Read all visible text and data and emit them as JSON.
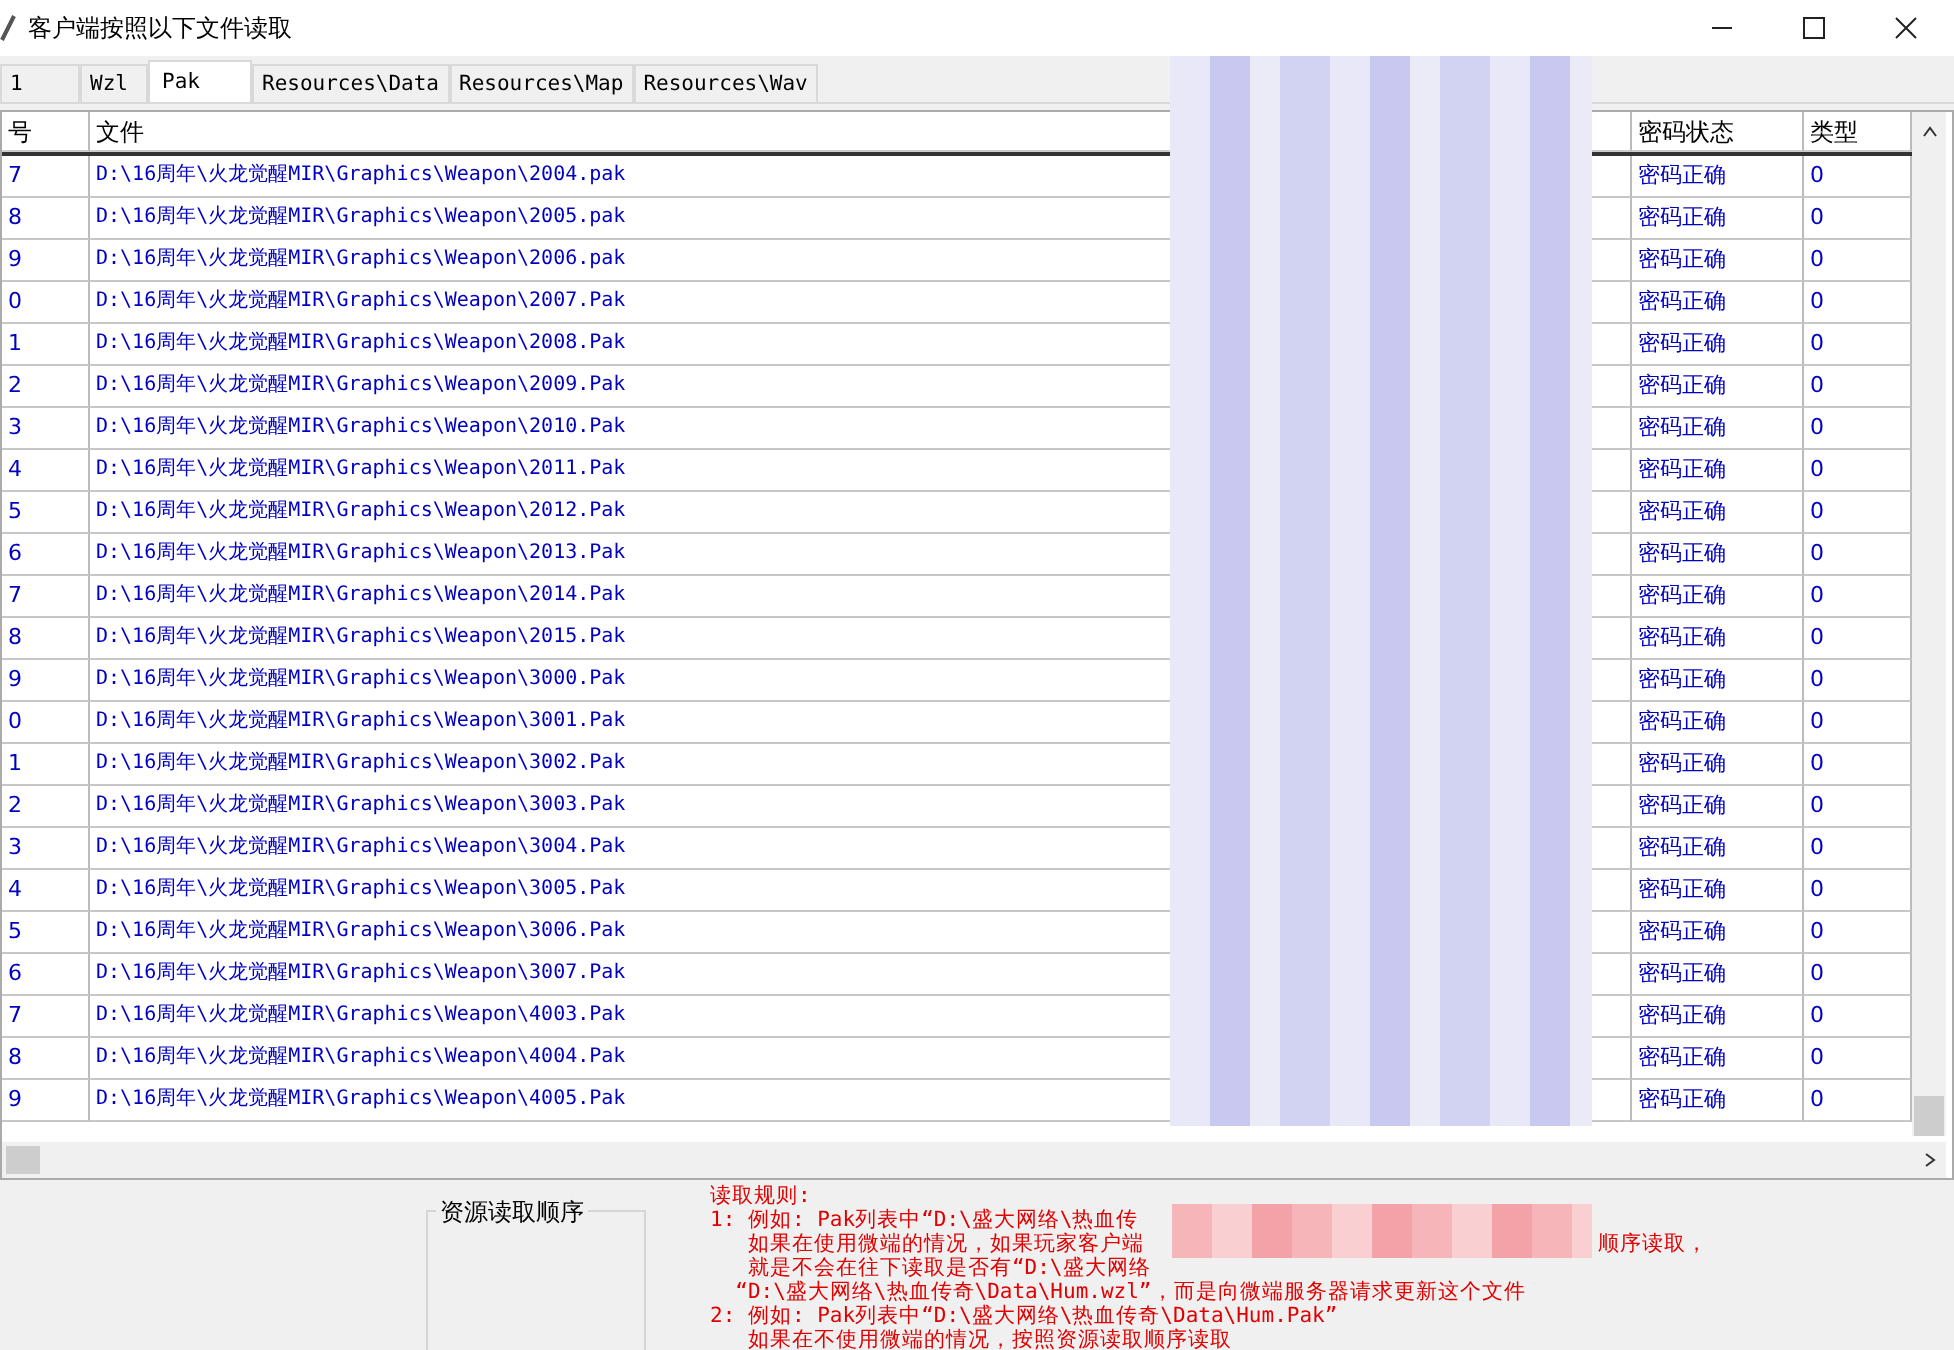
{
  "window": {
    "title": "客户端按照以下文件读取"
  },
  "tabs": [
    {
      "label": "1",
      "selected": false
    },
    {
      "label": "Wzl",
      "selected": false
    },
    {
      "label": "Pak",
      "selected": true
    },
    {
      "label": "Resources\\Data",
      "selected": false
    },
    {
      "label": "Resources\\Map",
      "selected": false
    },
    {
      "label": "Resources\\Wav",
      "selected": false
    }
  ],
  "table": {
    "columns": [
      "号",
      "文件",
      "密码状态",
      "类型"
    ],
    "rows": [
      {
        "no": "7",
        "file": "D:\\16周年\\火龙觉醒MIR\\Graphics\\Weapon\\2004.pak",
        "status": "密码正确",
        "type": "0"
      },
      {
        "no": "8",
        "file": "D:\\16周年\\火龙觉醒MIR\\Graphics\\Weapon\\2005.pak",
        "status": "密码正确",
        "type": "0"
      },
      {
        "no": "9",
        "file": "D:\\16周年\\火龙觉醒MIR\\Graphics\\Weapon\\2006.pak",
        "status": "密码正确",
        "type": "0"
      },
      {
        "no": "0",
        "file": "D:\\16周年\\火龙觉醒MIR\\Graphics\\Weapon\\2007.Pak",
        "status": "密码正确",
        "type": "0"
      },
      {
        "no": "1",
        "file": "D:\\16周年\\火龙觉醒MIR\\Graphics\\Weapon\\2008.Pak",
        "status": "密码正确",
        "type": "0"
      },
      {
        "no": "2",
        "file": "D:\\16周年\\火龙觉醒MIR\\Graphics\\Weapon\\2009.Pak",
        "status": "密码正确",
        "type": "0"
      },
      {
        "no": "3",
        "file": "D:\\16周年\\火龙觉醒MIR\\Graphics\\Weapon\\2010.Pak",
        "status": "密码正确",
        "type": "0"
      },
      {
        "no": "4",
        "file": "D:\\16周年\\火龙觉醒MIR\\Graphics\\Weapon\\2011.Pak",
        "status": "密码正确",
        "type": "0"
      },
      {
        "no": "5",
        "file": "D:\\16周年\\火龙觉醒MIR\\Graphics\\Weapon\\2012.Pak",
        "status": "密码正确",
        "type": "0"
      },
      {
        "no": "6",
        "file": "D:\\16周年\\火龙觉醒MIR\\Graphics\\Weapon\\2013.Pak",
        "status": "密码正确",
        "type": "0"
      },
      {
        "no": "7",
        "file": "D:\\16周年\\火龙觉醒MIR\\Graphics\\Weapon\\2014.Pak",
        "status": "密码正确",
        "type": "0"
      },
      {
        "no": "8",
        "file": "D:\\16周年\\火龙觉醒MIR\\Graphics\\Weapon\\2015.Pak",
        "status": "密码正确",
        "type": "0"
      },
      {
        "no": "9",
        "file": "D:\\16周年\\火龙觉醒MIR\\Graphics\\Weapon\\3000.Pak",
        "status": "密码正确",
        "type": "0"
      },
      {
        "no": "0",
        "file": "D:\\16周年\\火龙觉醒MIR\\Graphics\\Weapon\\3001.Pak",
        "status": "密码正确",
        "type": "0"
      },
      {
        "no": "1",
        "file": "D:\\16周年\\火龙觉醒MIR\\Graphics\\Weapon\\3002.Pak",
        "status": "密码正确",
        "type": "0"
      },
      {
        "no": "2",
        "file": "D:\\16周年\\火龙觉醒MIR\\Graphics\\Weapon\\3003.Pak",
        "status": "密码正确",
        "type": "0"
      },
      {
        "no": "3",
        "file": "D:\\16周年\\火龙觉醒MIR\\Graphics\\Weapon\\3004.Pak",
        "status": "密码正确",
        "type": "0"
      },
      {
        "no": "4",
        "file": "D:\\16周年\\火龙觉醒MIR\\Graphics\\Weapon\\3005.Pak",
        "status": "密码正确",
        "type": "0"
      },
      {
        "no": "5",
        "file": "D:\\16周年\\火龙觉醒MIR\\Graphics\\Weapon\\3006.Pak",
        "status": "密码正确",
        "type": "0"
      },
      {
        "no": "6",
        "file": "D:\\16周年\\火龙觉醒MIR\\Graphics\\Weapon\\3007.Pak",
        "status": "密码正确",
        "type": "0"
      },
      {
        "no": "7",
        "file": "D:\\16周年\\火龙觉醒MIR\\Graphics\\Weapon\\4003.Pak",
        "status": "密码正确",
        "type": "0"
      },
      {
        "no": "8",
        "file": "D:\\16周年\\火龙觉醒MIR\\Graphics\\Weapon\\4004.Pak",
        "status": "密码正确",
        "type": "0"
      },
      {
        "no": "9",
        "file": "D:\\16周年\\火龙觉醒MIR\\Graphics\\Weapon\\4005.Pak",
        "status": "密码正确",
        "type": "0"
      }
    ]
  },
  "order_group": {
    "title": "资源读取顺序"
  },
  "rules": {
    "heading": "读取规则:",
    "lines": [
      {
        "text": "1: 例如: Pak列表中“D:\\盛大网络\\热血传"
      },
      {
        "text": "   如果在使用微端的情况，如果玩家客户端",
        "tail": "顺序读取，"
      },
      {
        "text": "   就是不会在往下读取是否有“D:\\盛大网络"
      },
      {
        "text": "  “D:\\盛大网络\\热血传奇\\Data\\Hum.wzl”，而是向微端服务器请求更新这个文件"
      },
      {
        "text": "2: 例如: Pak列表中“D:\\盛大网络\\热血传奇\\Data\\Hum.Pak”"
      },
      {
        "text": "   如果在不使用微端的情况，按照资源读取顺序读取"
      }
    ]
  }
}
